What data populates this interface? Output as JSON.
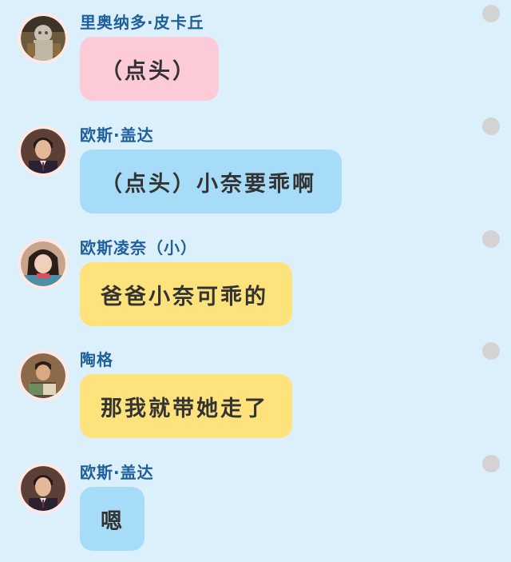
{
  "colors": {
    "background": "#dbf0fb",
    "name_text": "#1e5f9c",
    "message_text": "#333333",
    "bubble_pink": "#fdcbd7",
    "bubble_blue": "#a7dcf9",
    "bubble_yellow": "#fee27b",
    "status_dot": "#d3d3d3"
  },
  "messages": [
    {
      "sender": "里奥纳多·皮卡丘",
      "text": "（点头）",
      "bubble_color": "#fdcbd7",
      "avatar": "avatar-ornate-figure"
    },
    {
      "sender": "欧斯·盖达",
      "text": "（点头）小奈要乖啊",
      "bubble_color": "#a7dcf9",
      "avatar": "avatar-man-suit"
    },
    {
      "sender": "欧斯凌奈（小）",
      "text": "爸爸小奈可乖的",
      "bubble_color": "#fee27b",
      "avatar": "avatar-girl"
    },
    {
      "sender": "陶格",
      "text": "那我就带她走了",
      "bubble_color": "#fee27b",
      "avatar": "avatar-man-reading"
    },
    {
      "sender": "欧斯·盖达",
      "text": "嗯",
      "bubble_color": "#a7dcf9",
      "avatar": "avatar-man-suit"
    }
  ]
}
